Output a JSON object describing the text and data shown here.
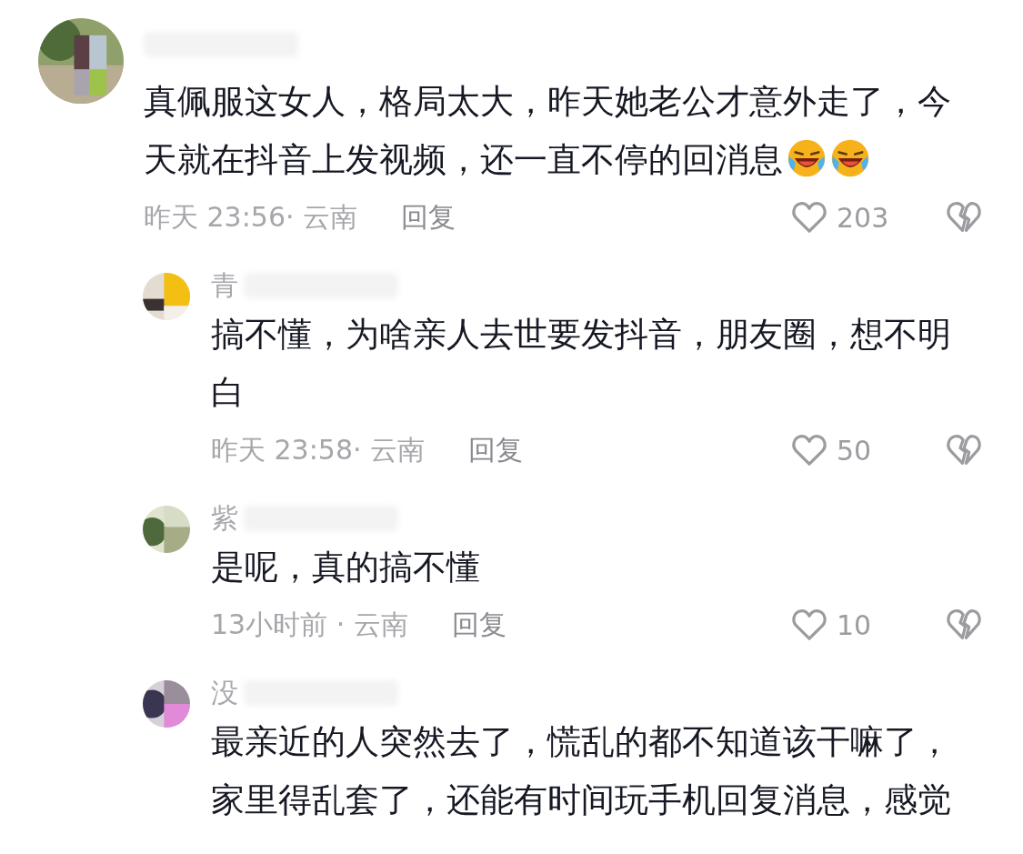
{
  "comments": [
    {
      "text": "真佩服这女人，格局太大，昨天她老公才意外走了，今天就在抖音上发视频，还一直不停的回消息",
      "emoji": [
        {
          "kind": "rolling-laugh"
        },
        {
          "kind": "rolling-laugh"
        }
      ],
      "meta": "昨天 23:56· 云南",
      "reply_label": "回复",
      "likes": "203",
      "liked": false,
      "replies": [
        {
          "author": "青",
          "text": "搞不懂，为啥亲人去世要发抖音，朋友圈，想不明白",
          "meta": "昨天 23:58· 云南",
          "reply_label": "回复",
          "likes": "50",
          "liked": false
        },
        {
          "author": "紫",
          "text": "是呢，真的搞不懂",
          "meta": "13小时前 · 云南",
          "reply_label": "回复",
          "likes": "10",
          "liked": false
        },
        {
          "author": "没",
          "text": "最亲近的人突然去了，慌乱的都不知道该干嘛了，家里得乱套了，还能有时间玩手机回复消息，感觉"
        }
      ]
    }
  ]
}
